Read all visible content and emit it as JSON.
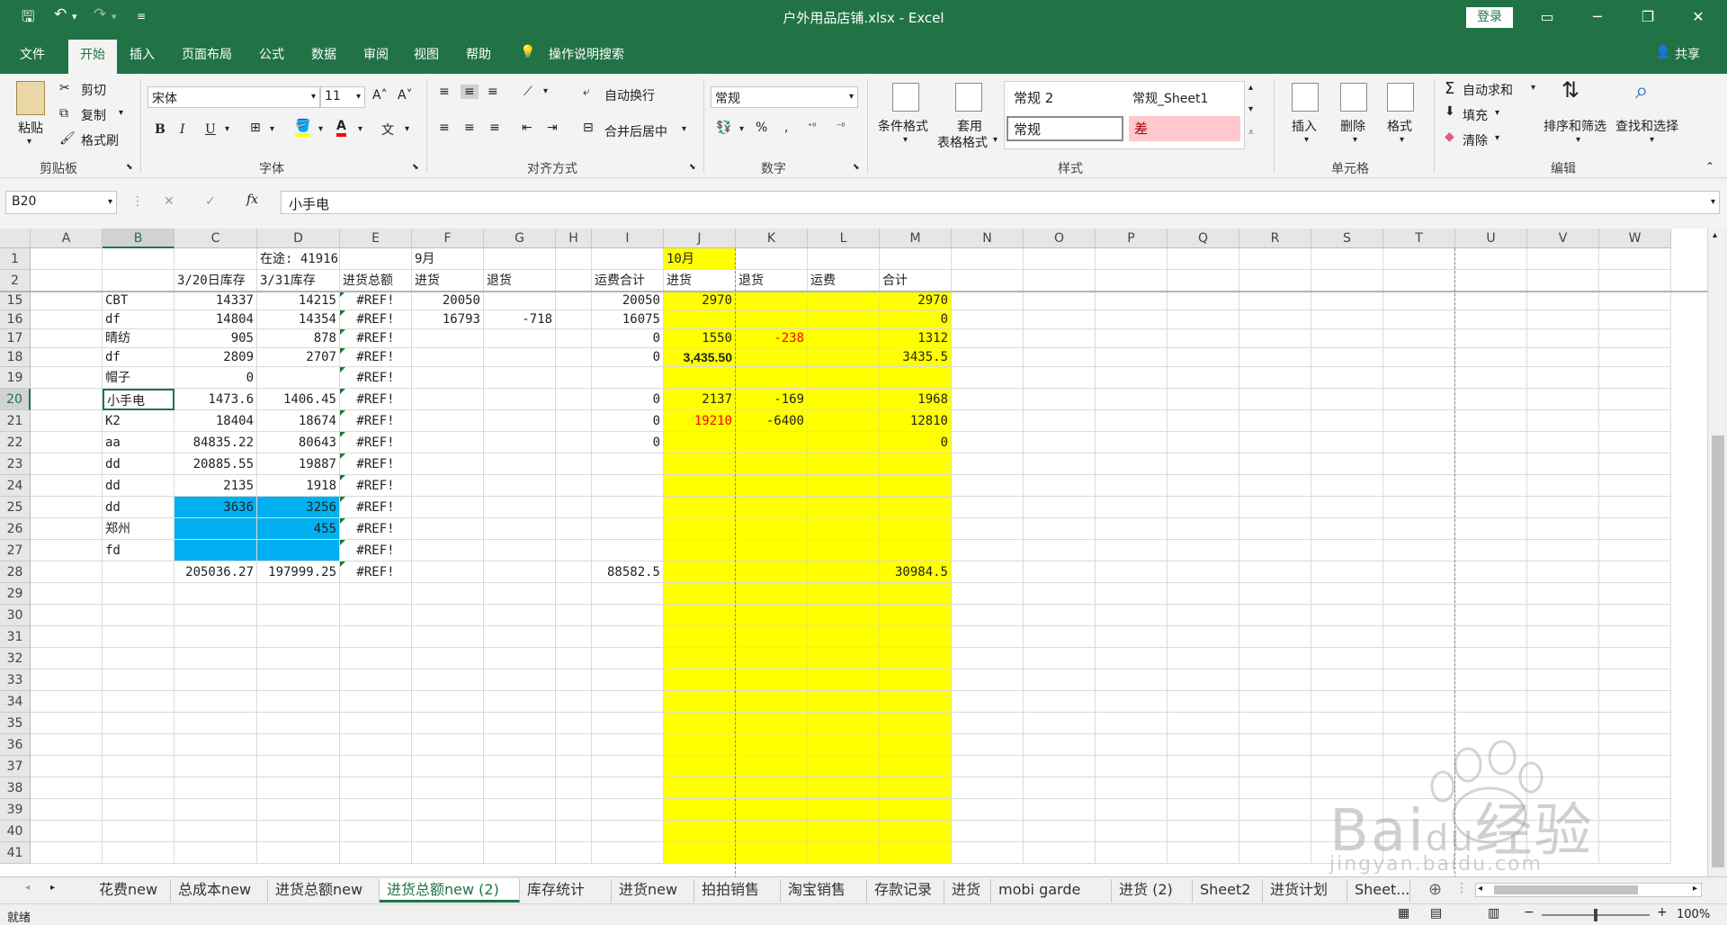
{
  "window": {
    "title": "户外用品店铺.xlsx  -  Excel",
    "login": "登录"
  },
  "menu": {
    "file": "文件",
    "home": "开始",
    "insert": "插入",
    "layout": "页面布局",
    "formula": "公式",
    "data": "数据",
    "review": "审阅",
    "view": "视图",
    "help": "帮助",
    "tell": "操作说明搜索",
    "share": "共享"
  },
  "ribbon": {
    "clipboard": {
      "paste": "粘贴",
      "cut": "剪切",
      "copy": "复制",
      "painter": "格式刷",
      "label": "剪贴板"
    },
    "font": {
      "name": "宋体",
      "size": "11",
      "label": "字体",
      "bold": "B",
      "italic": "I",
      "underline": "U"
    },
    "align": {
      "wrap": "自动换行",
      "merge": "合并后居中",
      "label": "对齐方式"
    },
    "number": {
      "format": "常规",
      "label": "数字"
    },
    "styles": {
      "cond": "条件格式",
      "table1": "套用",
      "table2": "表格格式",
      "s1": "常规 2",
      "s2": "常规_Sheet1",
      "s3": "常规",
      "s4": "差",
      "label": "样式"
    },
    "cells": {
      "insert": "插入",
      "delete": "删除",
      "format": "格式",
      "label": "单元格"
    },
    "edit": {
      "autosum": "自动求和",
      "fill": "填充",
      "clear": "清除",
      "sort": "排序和筛选",
      "find": "查找和选择",
      "label": "编辑"
    }
  },
  "formula_bar": {
    "name_box": "B20",
    "content": "小手电"
  },
  "columns": [
    "A",
    "B",
    "C",
    "D",
    "E",
    "F",
    "G",
    "H",
    "I",
    "J",
    "K",
    "L",
    "M",
    "N",
    "O",
    "P",
    "Q",
    "R",
    "S",
    "T",
    "U",
    "V",
    "W"
  ],
  "rows": [
    "1",
    "2",
    "15",
    "16",
    "17",
    "18",
    "19",
    "20",
    "21",
    "22",
    "23",
    "24",
    "25",
    "26",
    "27",
    "28",
    "29",
    "30",
    "31",
    "32",
    "33",
    "34",
    "35",
    "36",
    "37",
    "38",
    "39",
    "40",
    "41"
  ],
  "cells": {
    "r1": {
      "D": "在途: 41916",
      "F": "9月",
      "J": "10月"
    },
    "r2": {
      "C": "3/20日库存",
      "D": "3/31库存",
      "E": "进货总额",
      "F": "进货",
      "G": "退货",
      "I": "运费合计",
      "J": "进货",
      "K": "退货",
      "L": "运费",
      "M": "合计"
    },
    "r15": {
      "B": "CBT",
      "C": "14337",
      "D": "14215",
      "E": "#REF!",
      "F": "20050",
      "I": "20050",
      "J": "2970",
      "M": "2970"
    },
    "r16": {
      "B": "df",
      "C": "14804",
      "D": "14354",
      "E": "#REF!",
      "F": "16793",
      "G": "-718",
      "I": "16075",
      "M": "0"
    },
    "r17": {
      "B": "晴纺",
      "C": "905",
      "D": "878",
      "E": "#REF!",
      "I": "0",
      "J": "1550",
      "K": "-238",
      "M": "1312"
    },
    "r18": {
      "B": "df",
      "C": "2809",
      "D": "2707",
      "E": "#REF!",
      "I": "0",
      "J": "3,435.50",
      "M": "3435.5"
    },
    "r19": {
      "B": "帽子",
      "C": "0",
      "E": "#REF!"
    },
    "r20": {
      "B": "小手电",
      "C": "1473.6",
      "D": "1406.45",
      "E": "#REF!",
      "I": "0",
      "J": "2137",
      "K": "-169",
      "M": "1968"
    },
    "r21": {
      "B": "K2",
      "C": "18404",
      "D": "18674",
      "E": "#REF!",
      "I": "0",
      "J": "19210",
      "K": "-6400",
      "M": "12810"
    },
    "r22": {
      "B": "aa",
      "C": "84835.22",
      "D": "80643",
      "E": "#REF!",
      "I": "0",
      "M": "0"
    },
    "r23": {
      "B": "dd",
      "C": "20885.55",
      "D": "19887",
      "E": "#REF!"
    },
    "r24": {
      "B": "dd",
      "C": "2135",
      "D": "1918",
      "E": "#REF!"
    },
    "r25": {
      "B": "dd",
      "C": "3636",
      "D": "3256",
      "E": "#REF!"
    },
    "r26": {
      "B": "郑州",
      "D": "455",
      "E": "#REF!"
    },
    "r27": {
      "B": "fd",
      "E": "#REF!"
    },
    "r28": {
      "C": "205036.27",
      "D": "197999.25",
      "E": "#REF!",
      "I": "88582.5",
      "M": "30984.5"
    }
  },
  "sheet_tabs": [
    "花费new",
    "总成本new",
    "进货总额new",
    "进货总额new (2)",
    "库存统计",
    "进货new",
    "拍拍销售",
    "淘宝销售",
    "存款记录",
    "进货",
    "mobi garde",
    "进货 (2)",
    "Sheet2",
    "进货计划",
    "Sheet..."
  ],
  "active_sheet": "进货总额new (2)",
  "status": {
    "ready": "就绪",
    "zoom": "100%"
  },
  "colors": {
    "excel_green": "#217346",
    "highlight_yellow": "#ffff00",
    "fill_blue": "#00b0f0",
    "bad_pink": "#ffc7ce"
  },
  "watermark": {
    "brand": "Bai",
    "brand2": "du",
    "cn": "经验",
    "url": "jingyan.baidu.com"
  }
}
